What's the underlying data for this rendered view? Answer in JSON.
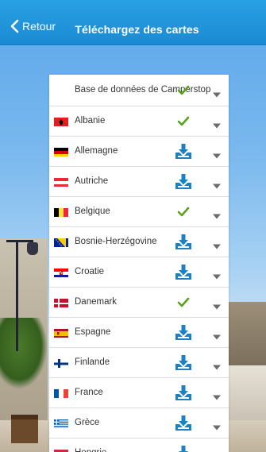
{
  "nav": {
    "back_label": "Retour",
    "title": "Téléchargez des cartes",
    "bar_color": "#1a8bd3"
  },
  "status_colors": {
    "downloaded": "#5aa11e",
    "download": "#1d7fc4"
  },
  "items": [
    {
      "label": "Base de données de Camperstop",
      "flag": "none",
      "status": "downloaded",
      "status_icon": "check-icon"
    },
    {
      "label": "Albanie",
      "flag": "al",
      "status": "downloaded",
      "status_icon": "check-icon"
    },
    {
      "label": "Allemagne",
      "flag": "de",
      "status": "download",
      "status_icon": "download-icon"
    },
    {
      "label": "Autriche",
      "flag": "at",
      "status": "download",
      "status_icon": "download-icon"
    },
    {
      "label": "Belgique",
      "flag": "be",
      "status": "downloaded",
      "status_icon": "check-icon"
    },
    {
      "label": "Bosnie-Herzégovine",
      "flag": "ba",
      "status": "download",
      "status_icon": "download-icon"
    },
    {
      "label": "Croatie",
      "flag": "hr",
      "status": "download",
      "status_icon": "download-icon"
    },
    {
      "label": "Danemark",
      "flag": "dk",
      "status": "downloaded",
      "status_icon": "check-icon"
    },
    {
      "label": "Espagne",
      "flag": "es",
      "status": "download",
      "status_icon": "download-icon"
    },
    {
      "label": "Finlande",
      "flag": "fi",
      "status": "download",
      "status_icon": "download-icon"
    },
    {
      "label": "France",
      "flag": "fr",
      "status": "download",
      "status_icon": "download-icon"
    },
    {
      "label": "Grèce",
      "flag": "gr",
      "status": "download",
      "status_icon": "download-icon"
    },
    {
      "label": "Hongrie",
      "flag": "hu",
      "status": "download",
      "status_icon": "download-icon"
    }
  ]
}
